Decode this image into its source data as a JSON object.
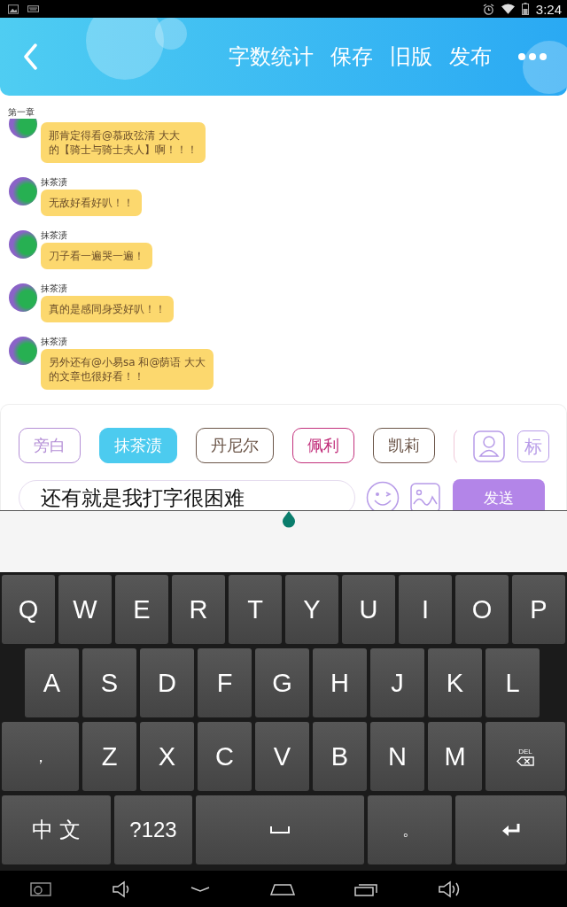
{
  "status_bar": {
    "time": "3:24"
  },
  "header": {
    "actions": [
      "字数统计",
      "保存",
      "旧版",
      "发布"
    ]
  },
  "chapter": "第一章",
  "messages": [
    {
      "lines": [
        "那肯定得看@慕政弦清 大大",
        "的【骑士与骑士夫人】啊！！！"
      ]
    },
    {
      "name": "抹茶渍",
      "lines": [
        "无敌好看好叭！！"
      ]
    },
    {
      "name": "抹茶渍",
      "lines": [
        "刀子看一遍哭一遍！"
      ]
    },
    {
      "name": "抹茶渍",
      "lines": [
        "真的是感同身受好叭！！"
      ]
    },
    {
      "name": "抹茶渍",
      "lines": [
        "另外还有@小易sa 和@荫语 大大",
        "的文章也很好看！！"
      ]
    }
  ],
  "composer": {
    "characters": [
      {
        "label": "旁白",
        "selected": false,
        "color": "#b48fd6"
      },
      {
        "label": "抹茶渍",
        "selected": true,
        "color": "#4ccbef"
      },
      {
        "label": "丹尼尔",
        "selected": false,
        "color": "#6b5548"
      },
      {
        "label": "佩利",
        "selected": false,
        "color": "#c2307c"
      },
      {
        "label": "凯莉",
        "selected": false,
        "color": "#6b5548"
      }
    ],
    "tag_button": "标",
    "input": {
      "value": "还有就是我打字很困难"
    },
    "send_button": "发送"
  },
  "keyboard": {
    "rows": [
      {
        "keys": [
          {
            "label": "Q"
          },
          {
            "label": "W"
          },
          {
            "label": "E"
          },
          {
            "label": "R"
          },
          {
            "label": "T"
          },
          {
            "label": "Y"
          },
          {
            "label": "U"
          },
          {
            "label": "I"
          },
          {
            "label": "O"
          },
          {
            "label": "P"
          }
        ]
      },
      {
        "keys": [
          {
            "label": "A"
          },
          {
            "label": "S"
          },
          {
            "label": "D"
          },
          {
            "label": "F"
          },
          {
            "label": "G"
          },
          {
            "label": "H"
          },
          {
            "label": "J"
          },
          {
            "label": "K"
          },
          {
            "label": "L"
          }
        ]
      },
      {
        "keys": [
          {
            "label": "，",
            "kind": "wide"
          },
          {
            "label": "Z"
          },
          {
            "label": "X"
          },
          {
            "label": "C"
          },
          {
            "label": "V"
          },
          {
            "label": "B"
          },
          {
            "label": "N"
          },
          {
            "label": "M"
          },
          {
            "label": "DEL",
            "kind": "delete"
          }
        ]
      },
      {
        "keys": [
          {
            "label": "中 文",
            "kind": "lang"
          },
          {
            "label": "?123",
            "kind": "symbols"
          },
          {
            "kind": "space"
          },
          {
            "label": "。",
            "kind": "period"
          },
          {
            "kind": "enter"
          }
        ]
      }
    ]
  }
}
